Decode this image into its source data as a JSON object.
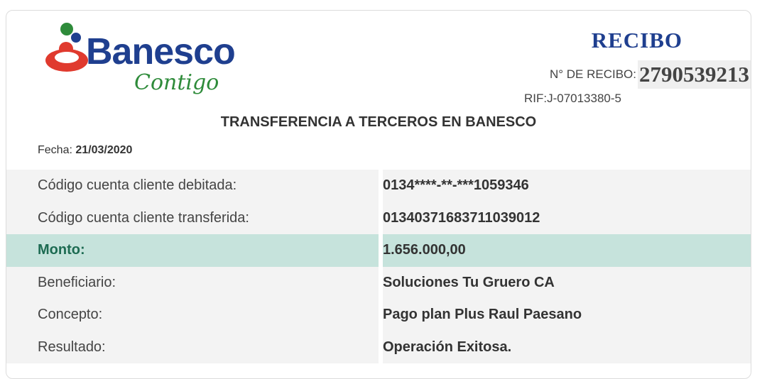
{
  "brand": {
    "name": "Banesco",
    "tagline": "Contigo",
    "colors": {
      "blue": "#1f3f8f",
      "green": "#2e8b3a",
      "red": "#e03a2e",
      "highlight": "#c6e3dc"
    }
  },
  "header": {
    "title": "RECIBO",
    "receipt_label": "N° DE RECIBO:",
    "receipt_number": "2790539213",
    "rif": "RIF:J-07013380-5"
  },
  "document": {
    "title": "TRANSFERENCIA A TERCEROS EN BANESCO",
    "date_label": "Fecha: ",
    "date_value": "21/03/2020"
  },
  "rows": [
    {
      "label": "Código cuenta cliente debitada:",
      "value": "0134****-**-***1059346"
    },
    {
      "label": "Código cuenta cliente transferida:",
      "value": "01340371683711039012"
    },
    {
      "label": "Monto:",
      "value": "1.656.000,00"
    },
    {
      "label": "Beneficiario:",
      "value": "Soluciones Tu Gruero CA"
    },
    {
      "label": "Concepto:",
      "value": "Pago plan Plus Raul Paesano"
    },
    {
      "label": "Resultado:",
      "value": "Operación Exitosa."
    }
  ]
}
